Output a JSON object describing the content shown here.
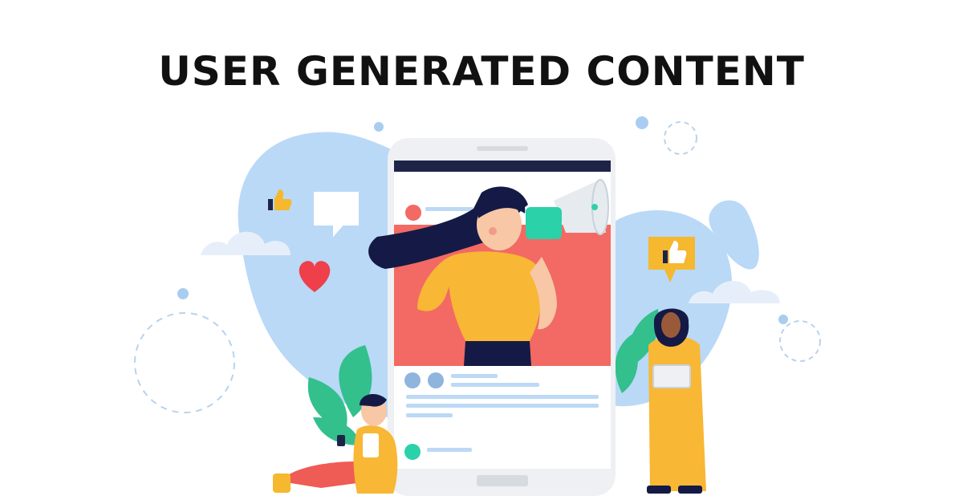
{
  "title": "USER GENERATED CONTENT",
  "colors": {
    "title": "#111111",
    "blob": "#b9d9f7",
    "dot": "#a9cdf0",
    "dash": "#b8d3ee",
    "phone_frame": "#eef0f3",
    "phone_bezel": "#d7dbe0",
    "post_header": "#1e2448",
    "post_bg": "#f26a63",
    "skeleton": "#bcd9f5",
    "avatar": "#8fb4dd",
    "accent_green": "#2bd1a8",
    "leaf": "#33c08d",
    "heart": "#ef3f4a",
    "yellow": "#f5b82e",
    "shirt": "#f8b734",
    "hair": "#141a45",
    "skin": "#f7c7a6",
    "skin_dark": "#9a5a3a",
    "pants_red": "#ef5b55",
    "megaphone": "#e6ebf0"
  },
  "icons": [
    "thumbs-up-icon",
    "chat-bubble-icon",
    "heart-icon",
    "like-badge-icon",
    "megaphone-icon"
  ]
}
